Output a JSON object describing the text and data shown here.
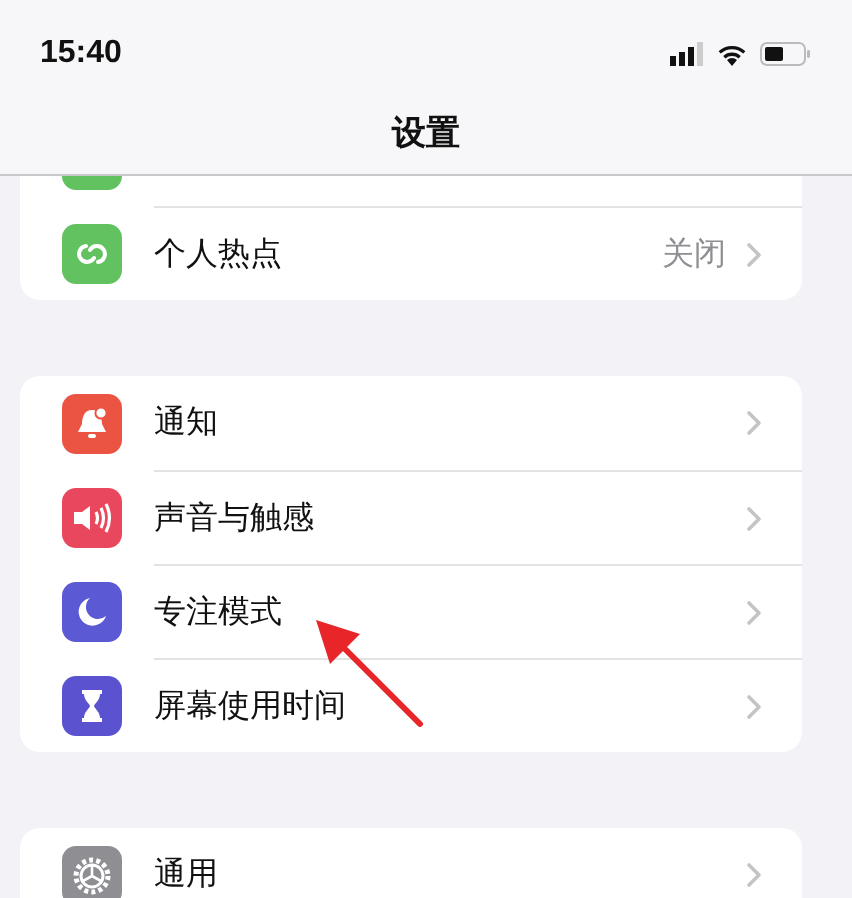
{
  "status_bar": {
    "time": "15:40"
  },
  "nav": {
    "title": "设置"
  },
  "groups": [
    {
      "items": [
        {
          "kind": "cellular",
          "color": "#62c25f",
          "cut_off": true
        },
        {
          "kind": "hotspot",
          "color": "#62c25f",
          "label": "个人热点",
          "value": "关闭",
          "cut_off": false
        }
      ]
    },
    {
      "items": [
        {
          "kind": "bell",
          "color": "#eb5442",
          "label": "通知",
          "cut_off": false
        },
        {
          "kind": "speaker",
          "color": "#e9475e",
          "label": "声音与触感",
          "cut_off": false
        },
        {
          "kind": "moon",
          "color": "#5b59d4",
          "label": "专注模式",
          "cut_off": false
        },
        {
          "kind": "hourglass",
          "color": "#5a52cf",
          "label": "屏幕使用时间",
          "cut_off": false
        }
      ]
    },
    {
      "items": [
        {
          "kind": "gear",
          "color": "#8e8e93",
          "label": "通用",
          "cut_off": false
        }
      ]
    }
  ],
  "annotation": {
    "kind": "arrow"
  }
}
